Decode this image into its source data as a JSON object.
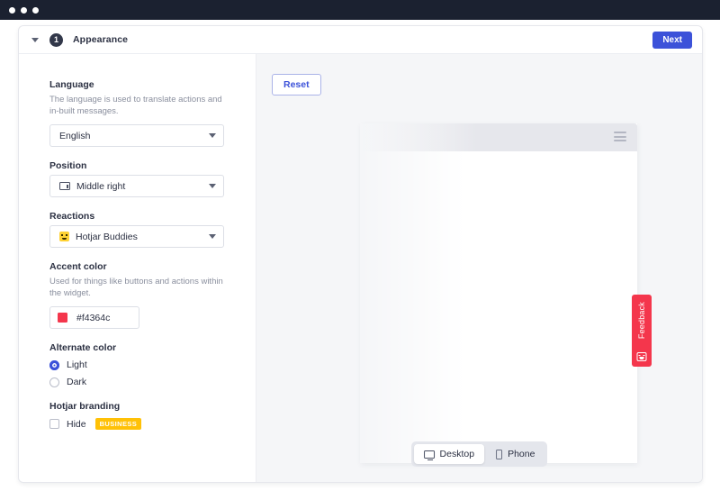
{
  "window": {
    "dots": 3
  },
  "header": {
    "step_number": "1",
    "title": "Appearance",
    "next_label": "Next",
    "caret_icon": "chevron-down-icon"
  },
  "form": {
    "language": {
      "label": "Language",
      "help": "The language is used to translate actions and in-built messages.",
      "value": "English"
    },
    "position": {
      "label": "Position",
      "value": "Middle right",
      "icon": "position-middle-right-icon"
    },
    "reactions": {
      "label": "Reactions",
      "value": "Hotjar Buddies",
      "icon": "smiley-icon"
    },
    "accent_color": {
      "label": "Accent color",
      "help": "Used for things like buttons and actions within the widget.",
      "value": "#f4364c",
      "swatch_color": "#f4364c"
    },
    "alternate_color": {
      "label": "Alternate color",
      "options": [
        {
          "label": "Light",
          "selected": true
        },
        {
          "label": "Dark",
          "selected": false
        }
      ]
    },
    "hotjar_branding": {
      "label": "Hotjar branding",
      "checkbox_label": "Hide",
      "checked": false,
      "badge": "BUSINESS",
      "badge_color": "#ffc107"
    }
  },
  "preview": {
    "reset_label": "Reset",
    "menu_icon": "hamburger-menu-icon",
    "feedback_tab": {
      "label": "Feedback",
      "color": "#f4364c",
      "icon": "smiley-face-icon"
    },
    "device_toggle": {
      "desktop_label": "Desktop",
      "phone_label": "Phone",
      "active": "Desktop"
    }
  },
  "colors": {
    "accent_blue": "#3c52d9",
    "titlebar": "#1b2130",
    "preview_bg": "#f5f6f8"
  }
}
